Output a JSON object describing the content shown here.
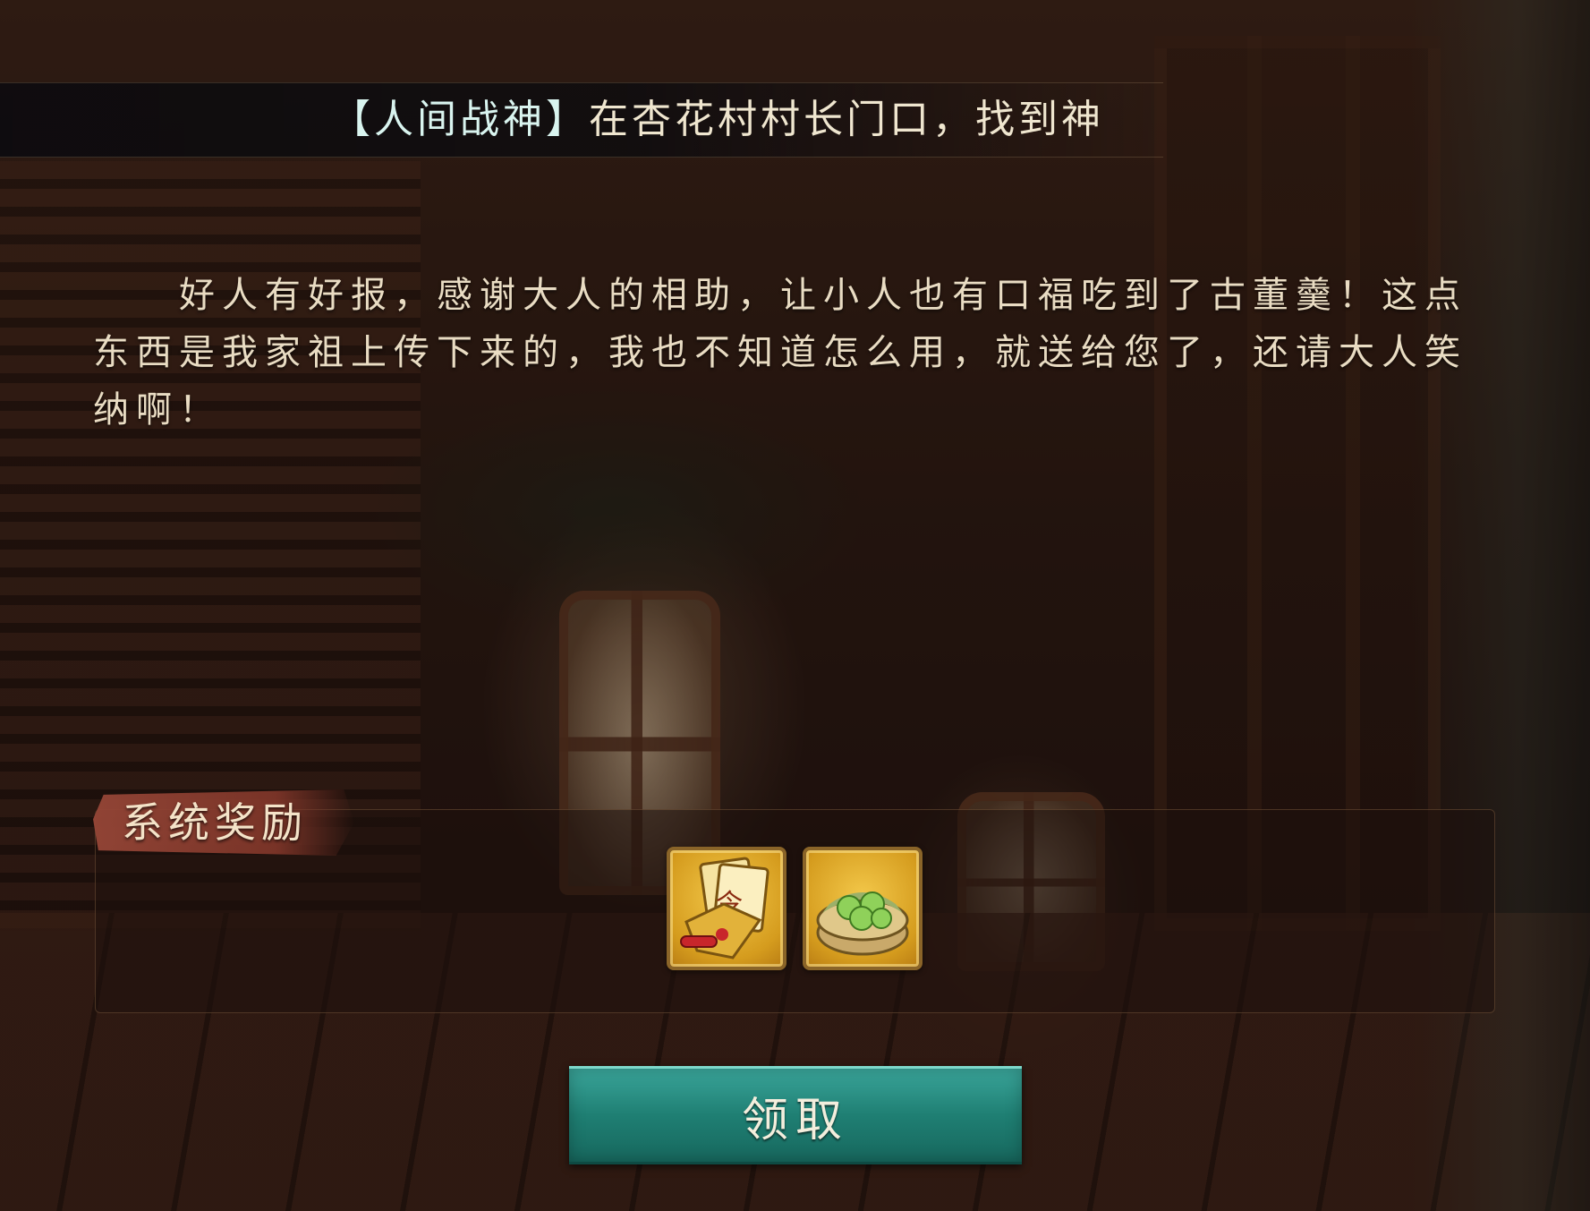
{
  "quest": {
    "bracket_open": "【",
    "title_name": "人间战神",
    "bracket_close": "】",
    "title_rest": "在杏花村村长门口，找到神"
  },
  "dialog": {
    "text": "好人有好报，感谢大人的相助，让小人也有口福吃到了古董羹！这点东西是我家祖上传下来的，我也不知道怎么用，就送给您了，还请大人笑纳啊！"
  },
  "rewards": {
    "header": "系统奖励",
    "items": [
      {
        "icon": "order-token-icon",
        "glyph": "令"
      },
      {
        "icon": "green-dumplings-icon"
      }
    ]
  },
  "buttons": {
    "claim_label": "领取"
  },
  "colors": {
    "accent_teal": "#1f7f73",
    "reward_tag": "#96463a",
    "item_gold": "#d59c1e"
  }
}
